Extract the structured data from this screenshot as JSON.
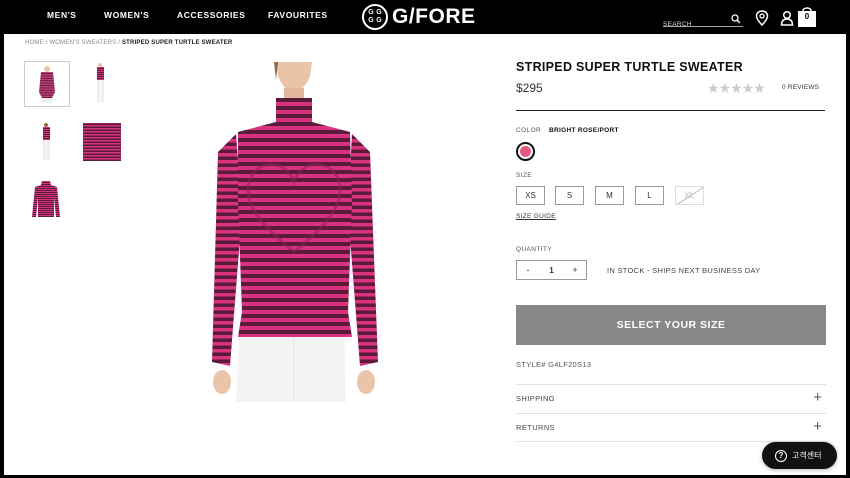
{
  "nav": {
    "links": [
      "MEN'S",
      "WOMEN'S",
      "ACCESSORIES",
      "FAVOURITES"
    ],
    "logo_text": "G/FORE",
    "logo_mark": [
      "G",
      "G",
      "G",
      "G"
    ],
    "search_placeholder": "SEARCH",
    "bag_count": "0",
    "icons": [
      "search-icon",
      "location-pin-icon",
      "user-icon",
      "shopping-bag-icon"
    ]
  },
  "breadcrumb": {
    "home": "HOME",
    "sep": "/",
    "category": "WOMEN'S SWEATERS",
    "current": "STRIPED SUPER TURTLE SWEATER"
  },
  "gallery": {
    "thumbnails": [
      "front view",
      "full length front",
      "full length back",
      "fabric detail",
      "flat lay"
    ],
    "active_index": 0
  },
  "product": {
    "title": "STRIPED SUPER TURTLE SWEATER",
    "price": "$295",
    "rating_stars": 0,
    "reviews": "0 REVIEWS",
    "color_label": "COLOR",
    "color_value": "BRIGHT ROSE/PORT",
    "swatch_color": "#e8577e",
    "size_label": "SIZE",
    "sizes": [
      {
        "label": "XS",
        "available": true
      },
      {
        "label": "S",
        "available": true
      },
      {
        "label": "M",
        "available": true
      },
      {
        "label": "L",
        "available": true
      },
      {
        "label": "XL",
        "available": false
      }
    ],
    "size_guide": "SIZE GUIDE",
    "quantity_label": "QUANTITY",
    "quantity_minus": "-",
    "quantity": "1",
    "quantity_plus": "+",
    "stock_status": "IN STOCK - SHIPS NEXT BUSINESS DAY",
    "cta": "SELECT YOUR SIZE",
    "style_number": "STYLE# G4LF20S13",
    "accordions": [
      {
        "label": "SHIPPING",
        "icon": "+"
      },
      {
        "label": "RETURNS",
        "icon": "+"
      }
    ]
  },
  "chat": {
    "icon": "?",
    "label": "고객센터"
  },
  "colors": {
    "stripe_pink": "#d9327f",
    "stripe_port": "#5a1a3a",
    "cta_bg": "#888888"
  }
}
